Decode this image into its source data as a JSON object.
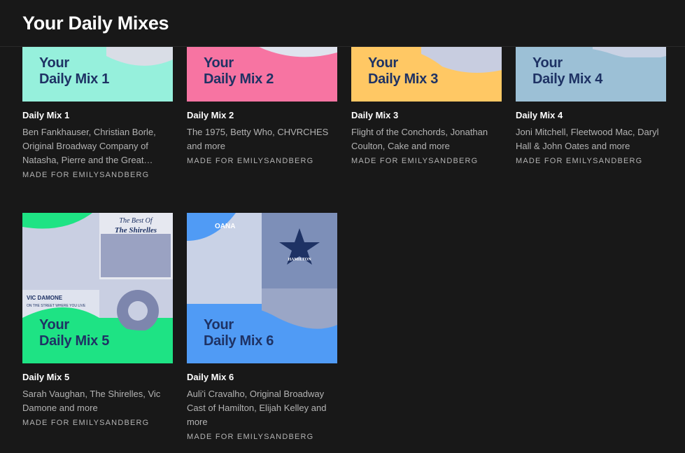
{
  "header": {
    "title": "Your Daily Mixes"
  },
  "mixes": [
    {
      "name": "Daily Mix 1",
      "cover_line1": "Your",
      "cover_line2": "Daily Mix 1",
      "cover_color": "#96f0dc",
      "artists": "Ben Fankhauser, Christian Borle, Original Broadway Company of Natasha, Pierre and the Great…",
      "made_for": "MADE FOR EMILYSANDBERG"
    },
    {
      "name": "Daily Mix 2",
      "cover_line1": "Your",
      "cover_line2": "Daily Mix 2",
      "cover_color": "#f774a2",
      "artists": "The 1975, Betty Who, CHVRCHES and more",
      "made_for": "MADE FOR EMILYSANDBERG"
    },
    {
      "name": "Daily Mix 3",
      "cover_line1": "Your",
      "cover_line2": "Daily Mix 3",
      "cover_color": "#ffc864",
      "artists": "Flight of the Conchords, Jonathan Coulton, Cake and more",
      "made_for": "MADE FOR EMILYSANDBERG"
    },
    {
      "name": "Daily Mix 4",
      "cover_line1": "Your",
      "cover_line2": "Daily Mix 4",
      "cover_color": "#9cc0d6",
      "artists": "Joni Mitchell, Fleetwood Mac, Daryl Hall & John Oates and more",
      "made_for": "MADE FOR EMILYSANDBERG"
    },
    {
      "name": "Daily Mix 5",
      "cover_line1": "Your",
      "cover_line2": "Daily Mix 5",
      "cover_color": "#1ee384",
      "artists": "Sarah Vaughan, The Shirelles, Vic Damone and more",
      "made_for": "MADE FOR EMILYSANDBERG",
      "art_text": {
        "best_of": "The Best Of",
        "shirelles": "The Shirelles",
        "vic": "VIC DAMONE",
        "vic_sub": "ON THE STREET WHERE YOU LIVE"
      }
    },
    {
      "name": "Daily Mix 6",
      "cover_line1": "Your",
      "cover_line2": "Daily Mix 6",
      "cover_color": "#509bf5",
      "artists": "Auli'i Cravalho, Original Broadway Cast of Hamilton, Elijah Kelley and more",
      "made_for": "MADE FOR EMILYSANDBERG",
      "art_text": {
        "moana": "OANA",
        "hamilton": "HAMILTON"
      }
    }
  ]
}
